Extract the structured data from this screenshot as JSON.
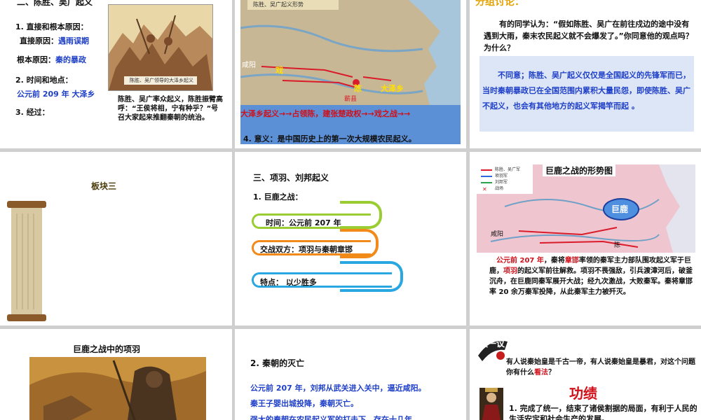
{
  "s1": {
    "heading": "二、陈胜、吴广起义",
    "l1": "1. 直接和根本原因：",
    "direct_label": "直接原因：",
    "direct_value": "遇雨误期",
    "root_label": "根本原因：",
    "root_value": "秦的暴政",
    "l2": "2. 时间和地点：",
    "time_place": "公元前 209 年  大泽乡",
    "l3": "3. 经过：",
    "img_caption": "陈胜、吴广领导的大泽乡起义",
    "caption": "陈胜、吴广率众起义，陈胜振臂高呼：“王侯将相，宁有种乎？”号召大家起来推翻秦朝的统治。"
  },
  "s2": {
    "map_title": "陈胜、吴广起义形势",
    "map_labels": [
      "咸阳",
      "戏",
      "陈",
      "大泽乡",
      "蕲县"
    ],
    "process": "大泽乡起义→→占领陈，建张楚政权→→戏之战→→",
    "meaning": "4. 意义：是中国历史上的第一次大规模农民起义。"
  },
  "s3": {
    "title": "分组讨论：",
    "question": "有的同学认为：“假如陈胜、吴广在前往戍边的途中没有遇到大雨，秦末农民起义就不会爆发了。”你同意他的观点吗？为什么？",
    "answer": "不同意；陈胜、吴广起义仅仅是全国起义的先锋军而已，当时秦朝暴政已在全国范围内累积大量民怨，即使陈胜、吴广不起义，也会有其他地方的起义军揭竿而起 。"
  },
  "s4": {
    "label": "板块三"
  },
  "s5": {
    "heading": "三、项羽、刘邦起义",
    "sub": "1. 巨鹿之战：",
    "time": "时间：公元前 207 年",
    "sides": "交战双方：项羽与秦朝章邯",
    "feature": "特点：  以少胜多"
  },
  "s6": {
    "map_title": "巨鹿之战的形势图",
    "legend": [
      "陈胜、吴广军",
      "项羽军",
      "刘邦军",
      "战场"
    ],
    "julu": "巨鹿",
    "map_labels": [
      "咸阳",
      "陈"
    ],
    "year": "公元前 207 年",
    "zhanghan": "章邯",
    "xiangyu": "项羽",
    "text_a": "，秦将",
    "text_b": "率领的秦军主力部队围攻起义军于巨鹿，",
    "text_c": "的起义军前往解救。项羽不畏强敌，引兵渡漳河后，破釜沉舟，在巨鹿同秦军展开大战；经九次激战，大败秦军。秦将章邯率 20 余万秦军投降，从此秦军主力被歼灭。"
  },
  "s7": {
    "title": "巨鹿之战中的项羽"
  },
  "s8": {
    "heading": "2. 秦朝的灭亡",
    "p1": "公元前 207 年，刘邦从武关进入关中，逼近咸阳。",
    "p2": "秦王子婴出城投降，秦朝灭亡。",
    "p3": "强大的秦朝在农民起义军的打击下，存在十几年"
  },
  "s9": {
    "badge": "议一议",
    "question_a": "有人说秦始皇是千古一帝，有人说秦始皇是暴君，对这个问题你有什么",
    "question_key": "看法",
    "question_b": "？",
    "title": "功绩",
    "item1": "1. 完成了统一，结束了诸侯割据的局面，有利于人民的生活安定和社会生产的发展。"
  }
}
